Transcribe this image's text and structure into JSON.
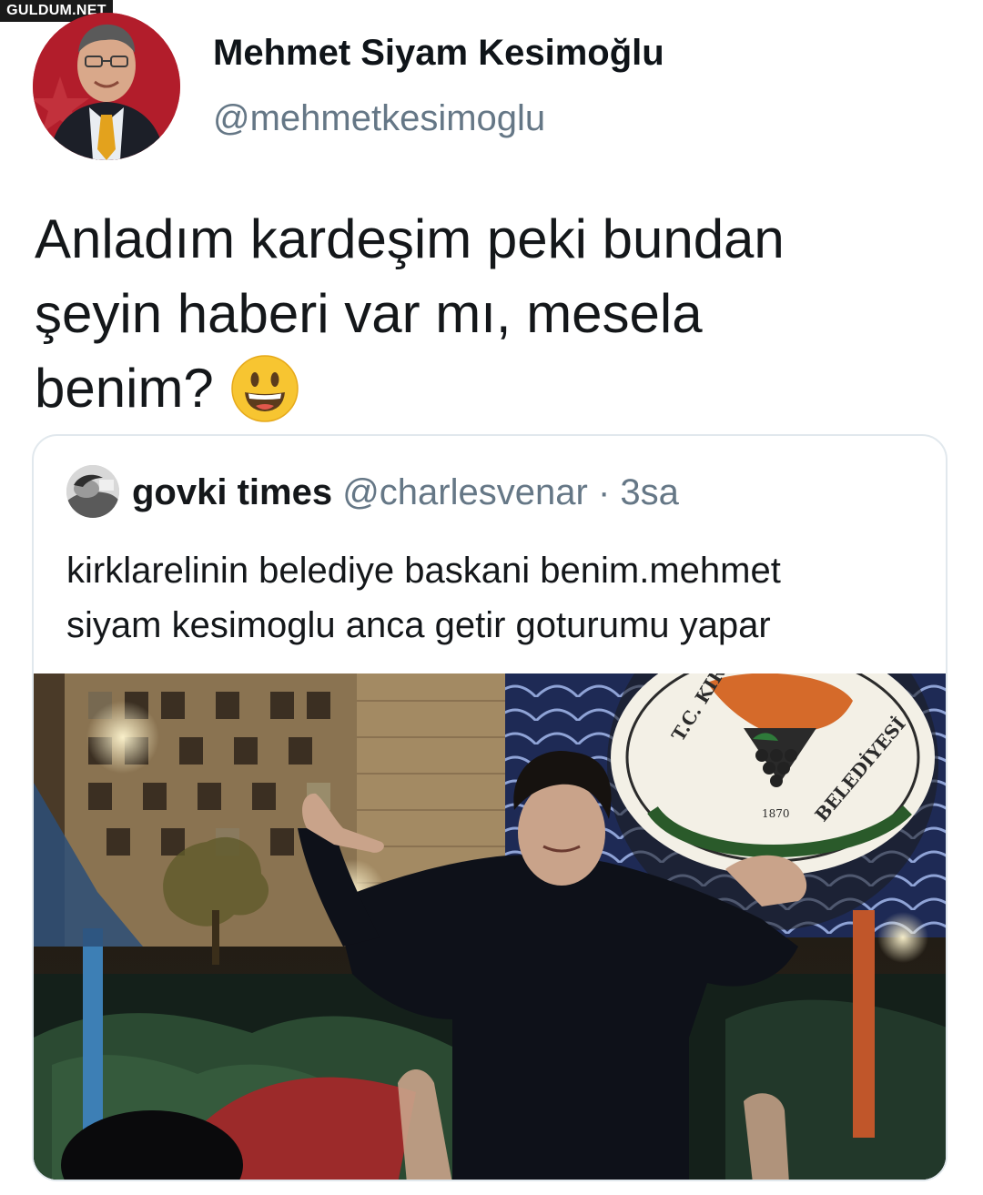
{
  "watermark": "GULDUM.NET",
  "tweet": {
    "author_name": "Mehmet Siyam Kesimoğlu",
    "author_handle": "@mehmetkesimoglu",
    "text_lines": [
      "Anladım kardeşim peki bundan",
      "şeyin haberi var mı, mesela",
      "benim?"
    ],
    "emoji": "grinning-face-emoji"
  },
  "quoted_tweet": {
    "author_name": "govki times",
    "author_handle": "@charlesvenar",
    "separator": "·",
    "time": "3sa",
    "text_lines": [
      "kirklarelinin belediye baskani benim.mehmet",
      "siyam kesimoglu anca getir goturumu yapar"
    ],
    "photo": {
      "seal_top": "T.C. KIRKLARELİ",
      "seal_bottom": "BELEDİYESİ",
      "seal_year": "1870"
    }
  },
  "colors": {
    "text": "#14171a",
    "secondary": "#657786",
    "border": "#e1e8ed",
    "avatar_bg": "#b21d2b",
    "emoji": "#f7c531"
  }
}
